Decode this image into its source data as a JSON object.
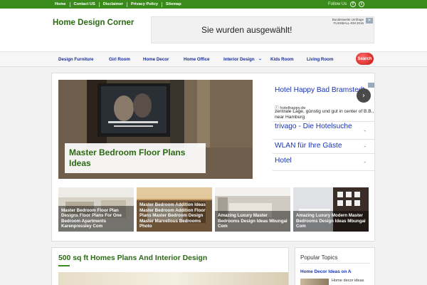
{
  "topbar": {
    "links": [
      "Home",
      "Contact US",
      "Disclaimer",
      "Privacy Policy",
      "Sitemap"
    ],
    "follow_label": "Follow Us",
    "social_icons": [
      "facebook-icon",
      "twitter-icon"
    ],
    "bg_color": "#3a8a1c"
  },
  "header": {
    "site_title": "Home Design Corner",
    "ad_banner": {
      "text": "Sie wurden ausgewählt!",
      "logo_text": "Bundesweite Umfrage FUSSBALL-EM 2016"
    }
  },
  "nav": {
    "items": [
      "Design Furniture",
      "Girl Room",
      "Home Decor",
      "Home Office",
      "Interior Design",
      "Kids Room",
      "Living Room"
    ],
    "dropdown_icon": "chevron-down-icon",
    "search_label": "Search"
  },
  "featured": {
    "title": "Master Bedroom Floor Plans Ideas"
  },
  "right_ad": {
    "items": [
      {
        "title": "Hotel Happy Bad Bramstedt",
        "url": "hotelhappy.de",
        "description": "zentrale Lage, günstig und gut in center of B.B., near Hamburg"
      },
      {
        "title": "trivago - Die Hotelsuche",
        "dash": "-"
      },
      {
        "title": "WLAN für Ihre Gäste",
        "dash": "-"
      },
      {
        "title": "Hotel",
        "dash": "-"
      }
    ],
    "arrow_icon": "chevron-right-icon"
  },
  "thumbnails": [
    "Master Bedroom Floor Plan Designs Floor Plans For One Bedroom Apartments Karenpressley Com",
    "Master Bedroom Addition Ideas Master Bedroom Addition Floor Plans Master Bedroom Design Master Marvellous Bedrooms Photo",
    "Amazing Luxury Master Bedrooms Design Ideas Mbungai Com",
    "Amazing Luxury Modern Master Bedrooms Design Ideas Mbungai Com"
  ],
  "article": {
    "title": "500 sq ft Homes Plans And Interior Design"
  },
  "sidebar": {
    "title": "Popular Topics",
    "link": "Home Decor Ideas on A",
    "description": "Home decor ideas"
  }
}
